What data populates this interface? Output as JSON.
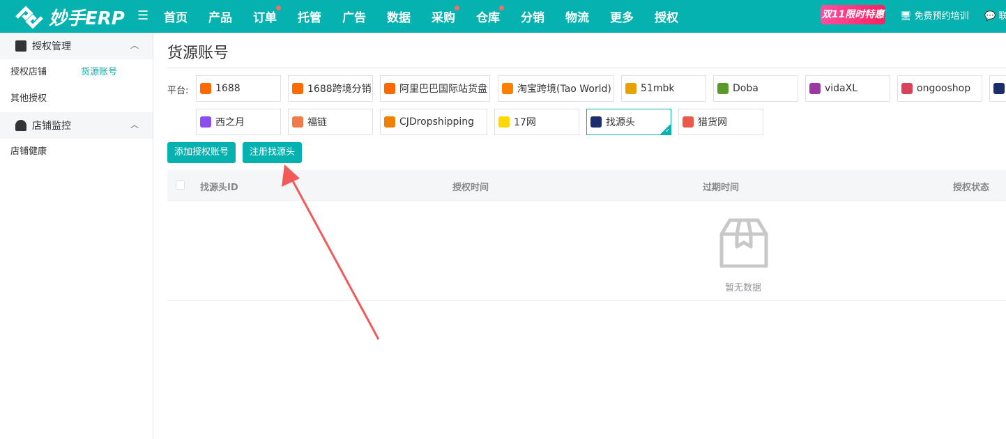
{
  "header": {
    "logo": "妙手ERP",
    "nav": [
      {
        "label": "首页",
        "dot": false
      },
      {
        "label": "产品",
        "dot": false
      },
      {
        "label": "订单",
        "dot": true
      },
      {
        "label": "托管",
        "dot": false
      },
      {
        "label": "广告",
        "dot": false
      },
      {
        "label": "数据",
        "dot": false
      },
      {
        "label": "采购",
        "dot": true
      },
      {
        "label": "仓库",
        "dot": true
      },
      {
        "label": "分销",
        "dot": false
      },
      {
        "label": "物流",
        "dot": false
      },
      {
        "label": "更多",
        "dot": false
      },
      {
        "label": "授权",
        "dot": false
      }
    ],
    "promo": "双11限时特惠",
    "training": "免费预约培训",
    "contact": "联"
  },
  "sidebar": {
    "group1": "授权管理",
    "item1": "授权店铺",
    "item1b": "货源账号",
    "item2": "其他授权",
    "group2": "店铺监控",
    "item3": "店铺健康"
  },
  "main": {
    "title": "货源账号",
    "platform_label": "平台:",
    "platforms": [
      "1688",
      "1688跨境分销",
      "阿里巴巴国际站货盘",
      "淘宝跨境(Tao World)",
      "51mbk",
      "Doba",
      "vidaXL",
      "ongooshop",
      "",
      "西之月",
      "福链",
      "CJDropshipping",
      "17网",
      "找源头",
      "猎货网"
    ],
    "selected_platform": "找源头",
    "add_button": "添加授权账号",
    "register_button": "注册找源头",
    "columns": [
      "找源头ID",
      "授权时间",
      "过期时间",
      "授权状态"
    ],
    "empty": "暂无数据"
  },
  "colors": {
    "accent": "#05b2b0",
    "arrow": "#f25a5a"
  }
}
